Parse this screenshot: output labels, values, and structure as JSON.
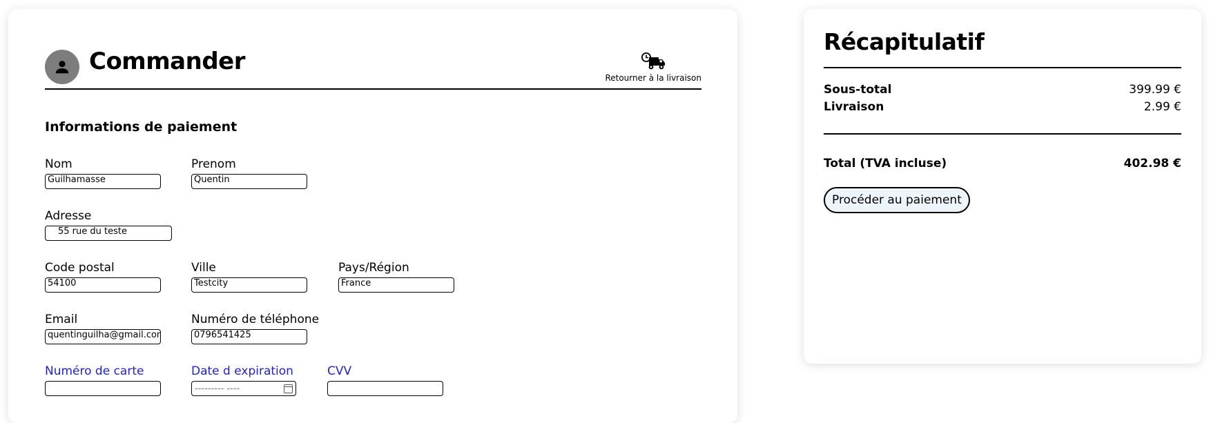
{
  "checkout": {
    "title": "Commander",
    "back_to_delivery": "Retourner à la livraison",
    "section_title": "Informations de paiement",
    "fields": {
      "nom": {
        "label": "Nom",
        "value": "Guilhamasse"
      },
      "prenom": {
        "label": "Prenom",
        "value": "Quentin"
      },
      "adresse": {
        "label": "Adresse",
        "value": "55 rue du teste"
      },
      "code_postal": {
        "label": "Code postal",
        "value": "54100"
      },
      "ville": {
        "label": "Ville",
        "value": "Testcity"
      },
      "pays": {
        "label": "Pays/Région",
        "value": "France"
      },
      "email": {
        "label": "Email",
        "value": "quentinguilha@gmail.com"
      },
      "telephone": {
        "label": "Numéro de téléphone",
        "value": "0796541425"
      },
      "carte": {
        "label": "Numéro de carte",
        "value": ""
      },
      "expiration": {
        "label": "Date d expiration",
        "placeholder": "--------- ----"
      },
      "cvv": {
        "label": "CVV",
        "value": ""
      }
    },
    "highlight_label_color": "#1f1fd6"
  },
  "summary": {
    "title": "Récapitulatif",
    "subtotal_label": "Sous-total",
    "subtotal_value": "399.99 €",
    "shipping_label": "Livraison",
    "shipping_value": "2.99 €",
    "total_label": "Total (TVA incluse)",
    "total_value": "402.98 €",
    "pay_button": "Procéder au paiement",
    "button_bg": "#edf5fb"
  },
  "icons": {
    "avatar": "person-icon",
    "delivery": "delivery-truck-clock-icon",
    "calendar": "calendar-icon"
  }
}
